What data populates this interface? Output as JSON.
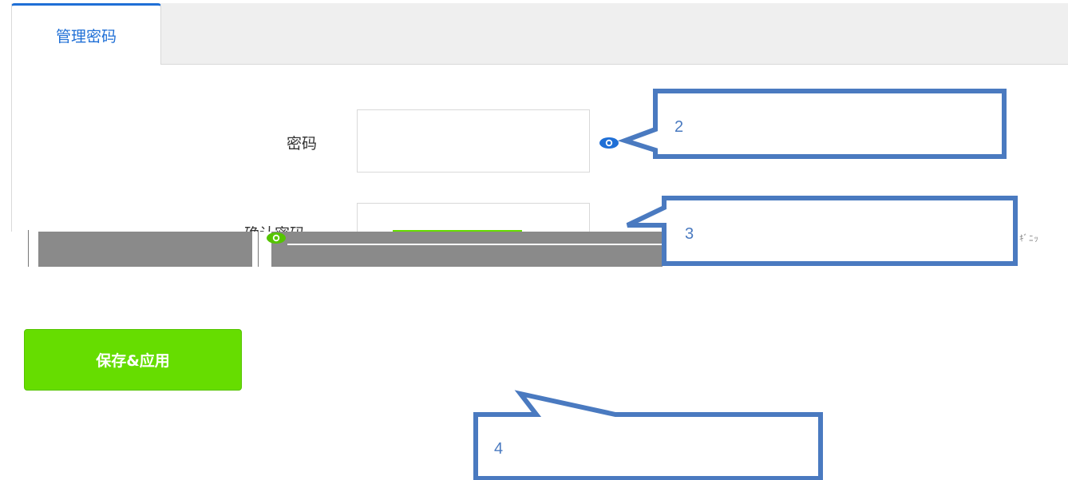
{
  "tab": {
    "label": "管理密码"
  },
  "form": {
    "password_label": "密码",
    "confirm_label": "确认密码",
    "password_value": "",
    "confirm_value": ""
  },
  "save_button": {
    "label": "保存&应用"
  },
  "callouts": [
    {
      "number": "2"
    },
    {
      "number": "3"
    },
    {
      "number": "4"
    }
  ],
  "colors": {
    "accent": "#1f6fd6",
    "save_button": "#66dd00",
    "callout_stroke": "#4a7ac0",
    "eye_icon_blue": "#1f6fd6",
    "eye_icon_green": "#55c400"
  }
}
